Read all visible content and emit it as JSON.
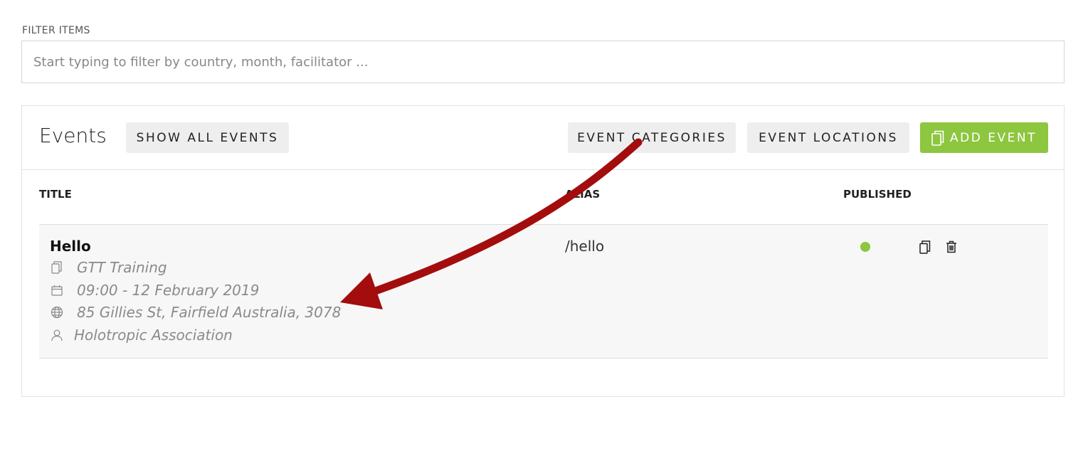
{
  "filter": {
    "label": "FILTER ITEMS",
    "placeholder": "Start typing to filter by country, month, facilitator ...",
    "value": ""
  },
  "panel": {
    "title": "Events",
    "buttons": {
      "show_all": "SHOW ALL EVENTS",
      "categories": "EVENT CATEGORIES",
      "locations": "EVENT LOCATIONS",
      "add": "ADD EVENT"
    },
    "columns": {
      "title": "TITLE",
      "alias": "ALIAS",
      "published": "PUBLISHED"
    },
    "rows": [
      {
        "title": "Hello",
        "category": "GTT Training",
        "datetime": "09:00 - 12 February 2019",
        "location": "85 Gillies St, Fairfield Australia, 3078",
        "organizer": "Holotropic Association",
        "alias": "/hello",
        "published": true
      }
    ]
  },
  "colors": {
    "accent_green": "#8dc63f",
    "annotation_arrow": "#a30d0d",
    "button_bg": "#eeeeee"
  },
  "icons": {
    "category": "copy-icon",
    "date": "calendar-icon",
    "location": "globe-icon",
    "organizer": "user-icon",
    "row_copy": "copy-icon",
    "row_delete": "trash-icon"
  }
}
